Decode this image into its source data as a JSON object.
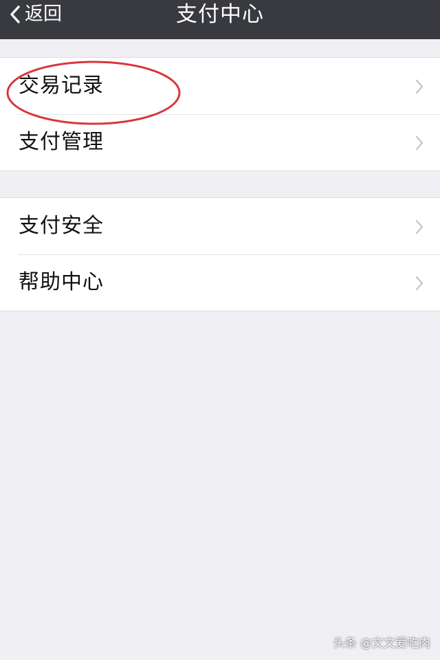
{
  "nav": {
    "back_label": "返回",
    "title": "支付中心",
    "background": "#393a3f"
  },
  "groups": [
    {
      "items": [
        {
          "label": "交易记录",
          "icon": "chevron-right-icon",
          "highlighted": true
        },
        {
          "label": "支付管理",
          "icon": "chevron-right-icon"
        }
      ]
    },
    {
      "items": [
        {
          "label": "支付安全",
          "icon": "chevron-right-icon"
        },
        {
          "label": "帮助中心",
          "icon": "chevron-right-icon"
        }
      ]
    }
  ],
  "annotation": {
    "shape": "ellipse",
    "color": "#d9363e",
    "target": "交易记录"
  },
  "watermark": "头条 @文文爱吃肉",
  "colors": {
    "page_background": "#efeff4",
    "cell_background": "#ffffff",
    "chevron": "#c7c7cc"
  }
}
